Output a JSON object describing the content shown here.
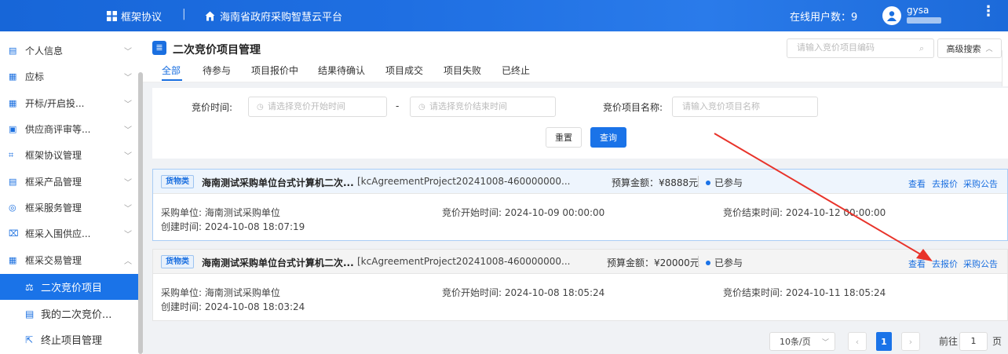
{
  "topbar": {
    "framework_label": "框架协议",
    "separator": "|",
    "platform_name": "海南省政府采购智慧云平台",
    "online_users": "在线用户数：9",
    "username": "gysa",
    "more": "⋮"
  },
  "sidebar": {
    "items": [
      {
        "label": "个人信息"
      },
      {
        "label": "应标"
      },
      {
        "label": "开标/开启投..."
      },
      {
        "label": "供应商评审等..."
      },
      {
        "label": "框架协议管理"
      },
      {
        "label": "框采产品管理"
      },
      {
        "label": "框采服务管理"
      },
      {
        "label": "框采入围供应..."
      },
      {
        "label": "框采交易管理"
      }
    ],
    "sub_items": [
      {
        "label": "二次竞价项目"
      },
      {
        "label": "我的二次竞价..."
      },
      {
        "label": "终止项目管理"
      }
    ]
  },
  "page": {
    "title": "二次竞价项目管理",
    "tabs": [
      "全部",
      "待参与",
      "项目报价中",
      "结果待确认",
      "项目成交",
      "项目失败",
      "已终止"
    ],
    "search_placeholder": "请输入竞价项目编码",
    "advanced_search": "高级搜索"
  },
  "filters": {
    "time_label": "竞价时间:",
    "start_placeholder": "请选择竞价开始时间",
    "dash": "-",
    "end_placeholder": "请选择竞价结束时间",
    "name_label": "竞价项目名称:",
    "name_placeholder": "请输入竞价项目名称",
    "reset": "重置",
    "query": "查询"
  },
  "projects": [
    {
      "tag": "货物类",
      "name": "海南测试采购单位台式计算机二次...",
      "code": "[kcAgreementProject20241008-460000000...",
      "budget": "预算金额：¥8888元",
      "status": "已参与",
      "actions": [
        "查看",
        "去报价",
        "采购公告"
      ],
      "unit": "采购单位: 海南测试采购单位",
      "start": "竞价开始时间: 2024-10-09 00:00:00",
      "end": "竞价结束时间: 2024-10-12 00:00:00",
      "created": "创建时间: 2024-10-08 18:07:19"
    },
    {
      "tag": "货物类",
      "name": "海南测试采购单位台式计算机二次...",
      "code": "[kcAgreementProject20241008-460000000...",
      "budget": "预算金额：¥20000元",
      "status": "已参与",
      "actions": [
        "查看",
        "去报价",
        "采购公告"
      ],
      "unit": "采购单位: 海南测试采购单位",
      "start": "竞价开始时间: 2024-10-08 18:05:24",
      "end": "竞价结束时间: 2024-10-11 18:05:24",
      "created": "创建时间: 2024-10-08 18:03:24"
    }
  ],
  "pagination": {
    "page_size": "10条/页",
    "prev": "‹",
    "current": "1",
    "next": "›",
    "goto_label": "前往",
    "goto_value": "1",
    "page_suffix": "页"
  },
  "colors": {
    "accent": "#1a73e8",
    "annotation_arrow": "#e8332a"
  }
}
